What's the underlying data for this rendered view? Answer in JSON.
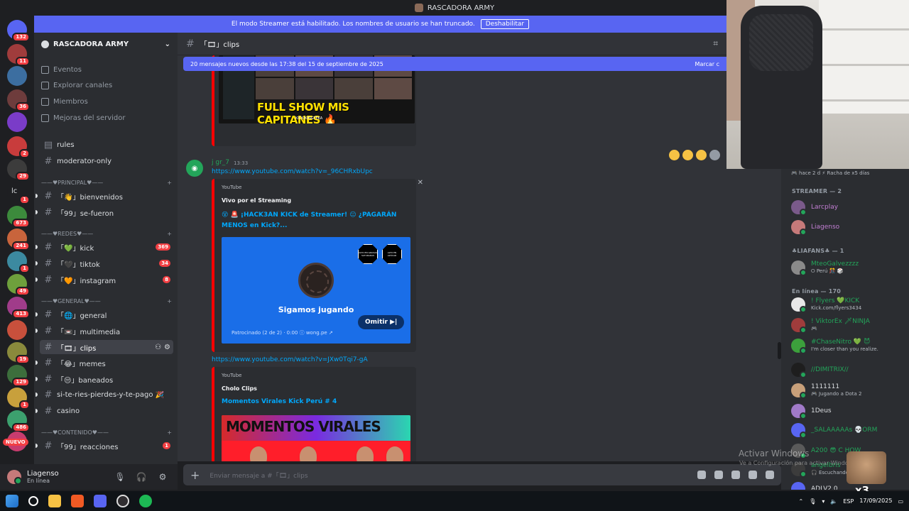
{
  "window": {
    "title": "RASCADORA ARMY"
  },
  "banner": {
    "text": "El modo Streamer está habilitado. Los nombres de usuario se han truncado.",
    "button": "Deshabilitar"
  },
  "rail": {
    "servers": [
      {
        "badge": "132",
        "color": "#5865f2"
      },
      {
        "badge": "11",
        "color": "#a03c3c"
      },
      {
        "badge": "",
        "color": "#3c6ea0"
      },
      {
        "badge": "36",
        "color": "#6e3c3c"
      },
      {
        "badge": "",
        "color": "#7a3cc8"
      },
      {
        "badge": "2",
        "color": "#c83c3c"
      },
      {
        "badge": "29",
        "color": "#3c3c3c"
      },
      {
        "badge": "1",
        "color": "#1e1f22",
        "label": "lc"
      },
      {
        "badge": "673",
        "color": "#3c8a3c"
      },
      {
        "badge": "241",
        "color": "#c8643c"
      },
      {
        "badge": "1",
        "color": "#3c8aa0"
      },
      {
        "badge": "49",
        "color": "#6ea03c"
      },
      {
        "badge": "413",
        "color": "#a03c8a"
      },
      {
        "badge": "",
        "color": "#c8503c"
      },
      {
        "badge": "19",
        "color": "#8a8a3c"
      },
      {
        "badge": "129",
        "color": "#3c6e3c"
      },
      {
        "badge": "1",
        "color": "#c8a03c"
      },
      {
        "badge": "486",
        "color": "#3ca06e"
      },
      {
        "badge": "",
        "color": "#c83c6e"
      }
    ],
    "new_label": "NUEVO"
  },
  "sidebar": {
    "server_name": "RASCADORA ARMY",
    "nav": [
      {
        "label": "Eventos"
      },
      {
        "label": "Explorar canales"
      },
      {
        "label": "Miembros"
      },
      {
        "label": "Mejoras del servidor"
      }
    ],
    "top_channels": [
      {
        "name": "rules",
        "icon": "rules-icon"
      },
      {
        "name": "moderator-only"
      }
    ],
    "categories": [
      {
        "label": "——♥PRINCIPAL♥——",
        "channels": [
          {
            "name": "「👋」bienvenidos"
          },
          {
            "name": "「99」se-fueron"
          }
        ]
      },
      {
        "label": "——♥REDES♥——",
        "channels": [
          {
            "name": "「💚」kick",
            "badge": "369"
          },
          {
            "name": "「🖤」tiktok",
            "badge": "34"
          },
          {
            "name": "「🧡」instagram",
            "badge": "8"
          }
        ]
      },
      {
        "label": "——♥GENERAL♥——",
        "channels": [
          {
            "name": "「🌐」general"
          },
          {
            "name": "「📼」multimedia"
          },
          {
            "name": "「🎞」clips",
            "active": true
          },
          {
            "name": "「😂」memes"
          },
          {
            "name": "「😒」baneados"
          },
          {
            "name": "si-te-ries-pierdes-y-te-pago 🎉"
          },
          {
            "name": "casino"
          }
        ]
      },
      {
        "label": "——♥CONTENIDO♥——",
        "channels": [
          {
            "name": "「99」reacciones",
            "badge": "1"
          }
        ]
      }
    ]
  },
  "user": {
    "name": "Liagenso",
    "status": "En línea"
  },
  "channel": {
    "name": "「🎞」clips"
  },
  "new_messages": {
    "text": "20 mensajes nuevos desde las 17:38 del 15 de septiembre de 2025",
    "action": "Marcar c"
  },
  "messages": {
    "thumb1_text": "FULL SHOW MIS CAPITANES 🔥",
    "thumb1_sub": "KICK/KINGTEKA",
    "author": "j gr_7",
    "time": "13:33",
    "link1": "https://www.youtube.com/watch?v=_96CHRxbUpc",
    "embed1": {
      "provider": "YouTube",
      "author": "Vivo por el Streaming",
      "title": "😵 🚨 ¡HACK3AN KICK de Streamer! 😐 ¿PAGARÁN MENOS en Kick?...",
      "ad_slogan": "Sigamos jugando",
      "ad_badge1": "ALTO EN GRASAS SATURADAS",
      "ad_badge2": "ALTO EN AZÚCAR",
      "ad_footer": "Patrocinado (2 de 2) · 0:00 ⓘ wong.pe ↗",
      "skip": "Omitir ▶|"
    },
    "link2": "https://www.youtube.com/watch?v=JXw0Tqi7-gA",
    "embed2": {
      "provider": "YouTube",
      "author": "Cholo Clips",
      "title": "Momentos Virales Kick Perú # 4",
      "thumb_text": "MOMENTOS VIRALES"
    }
  },
  "input": {
    "placeholder": "Enviar mensaje a #「🎞」clips"
  },
  "members": {
    "top_status": "🎮 hace 2 d  ⚡ Racha de x5 días",
    "groups": [
      {
        "label": "STREAMER — 2",
        "items": [
          {
            "name": "Larcplay",
            "color": "#c37fd4",
            "av": "#7a5a8a"
          },
          {
            "name": "Liagenso",
            "color": "#c37fd4",
            "av": "#c67a7a"
          }
        ]
      },
      {
        "label": "♣LIAFANS♣ — 1",
        "items": [
          {
            "name": "MteoGalvezzzz",
            "status": "⭘ Perú 🎊 🎲",
            "color": "#23a55a",
            "av": "#8a8a8a"
          }
        ]
      },
      {
        "label": "En línea — 170",
        "items": [
          {
            "name": "! Flyers 💚KICK",
            "status": "Kick.com/flyers3434",
            "color": "#23a55a",
            "av": "#e8e8e8"
          },
          {
            "name": "! ViktorEx 🗡NINJA",
            "status": "🎮",
            "color": "#23a55a",
            "av": "#a03c3c"
          },
          {
            "name": "#ChaseNitro 💚 😈",
            "status": "I'm closer than you realize.",
            "color": "#23a55a",
            "av": "#3ca03c"
          },
          {
            "name": "//DIMITRIX//",
            "status": "",
            "color": "#23a55a",
            "av": "#1e1e1e"
          },
          {
            "name": "1111111",
            "status": "🎮 Jugando a Dota 2",
            "color": "#dbdee1",
            "av": "#c8a07a"
          },
          {
            "name": "1Deus",
            "status": "",
            "color": "#dbdee1",
            "av": "#a07ac8"
          },
          {
            "name": "_SALAAAAAs 💀ORM",
            "status": "",
            "color": "#23a55a",
            "av": "#5865f2"
          },
          {
            "name": "A200 😎 C HOW",
            "status": "",
            "color": "#23a55a",
            "av": "#5a5a5a"
          },
          {
            "name": "angelbris",
            "status": "🎧 Escuchando",
            "color": "#23a55a",
            "av": "#3c3c3c"
          },
          {
            "name": "ADLV2.0",
            "status": "",
            "color": "#dbdee1",
            "av": "#5865f2"
          }
        ]
      }
    ]
  },
  "watermark": {
    "line1": "Activar Windows",
    "line2": "Ve a Configuración para activar Windows."
  },
  "emote_text": "x3",
  "tray": {
    "lang": "ESP",
    "time": "17:09/2025",
    "date": "17/09/2025"
  }
}
